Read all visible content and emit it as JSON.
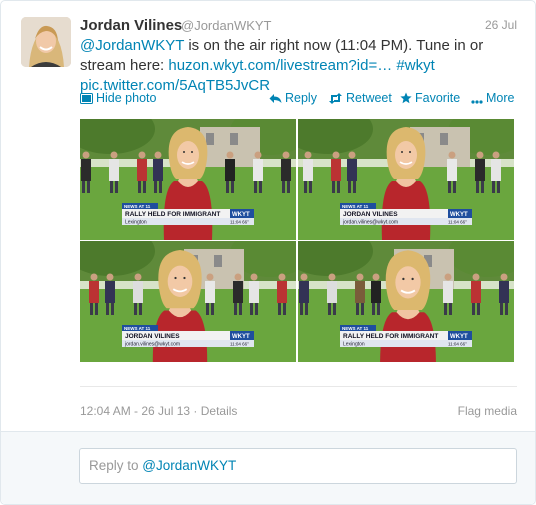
{
  "tweet": {
    "author_name": "Jordan Vilines",
    "author_handle": "@JordanWKYT",
    "date": "26 Jul",
    "text": {
      "mention": "@JordanWKYT",
      "part1": " is on the air right now (11:04 PM). Tune in or stream here: ",
      "link": "huzon.wkyt.com/livestream?id=…",
      "hashtag": "#wkyt",
      "pic": "pic.twitter.com/5AqTB5JvCR"
    },
    "actions": {
      "hide_photo": "Hide photo",
      "reply": "Reply",
      "retweet": "Retweet",
      "favorite": "Favorite",
      "more": "More"
    },
    "media": {
      "lower_thirds": [
        {
          "name": "JORDAN VILINES",
          "sub": "jordan.vilines@wkyt.com",
          "top": "NEWS AT 11",
          "station": "WKYT",
          "time": "11:04",
          "temp": "66°"
        },
        {
          "name": "JORDAN VILINES",
          "sub": "jordan.vilines@wkyt.com",
          "top": "NEWS AT 11",
          "station": "WKYT",
          "time": "11:04",
          "temp": "66°"
        },
        {
          "name": "JORDAN VILINES",
          "sub": "jordan.vilines@wkyt.com",
          "top": "NEWS AT 11",
          "station": "WKYT",
          "time": "11:04",
          "temp": "66°"
        },
        {
          "name": "JORDAN VILINES",
          "sub": "jordan.vilines@wkyt.com",
          "top": "NEWS AT 11",
          "station": "WKYT",
          "time": "11:04",
          "temp": "66°"
        }
      ],
      "headline": "RALLY HELD FOR IMMIGRANT",
      "location": "Lexington"
    },
    "footer": {
      "timestamp": "12:04 AM - 26 Jul 13",
      "details": "Details",
      "flag": "Flag media"
    }
  },
  "reply": {
    "prefix": "Reply to ",
    "handle": "@JordanWKYT"
  },
  "colors": {
    "link": "#0084b4",
    "muted": "#999999",
    "dress": "#b8262c",
    "grass": "#6aa63e"
  }
}
